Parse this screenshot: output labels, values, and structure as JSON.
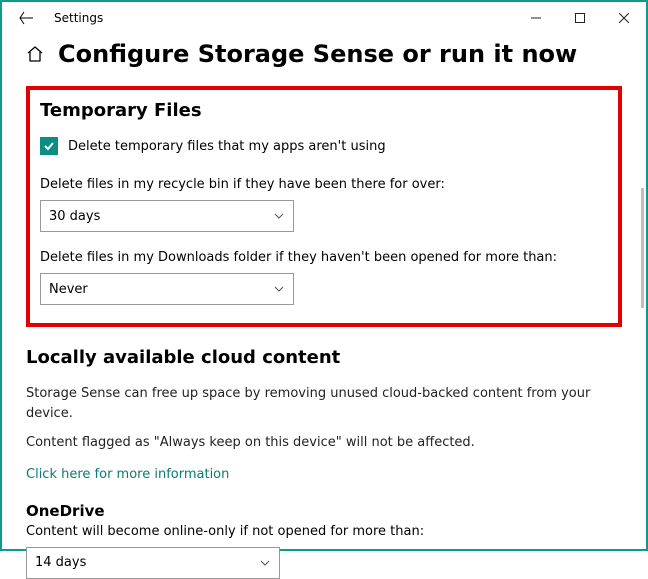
{
  "window": {
    "title": "Settings"
  },
  "page": {
    "title": "Configure Storage Sense or run it now"
  },
  "temporary_files": {
    "heading": "Temporary Files",
    "delete_temp_label": "Delete temporary files that my apps aren't using",
    "recycle_label": "Delete files in my recycle bin if they have been there for over:",
    "recycle_value": "30 days",
    "downloads_label": "Delete files in my Downloads folder if they haven't been opened for more than:",
    "downloads_value": "Never"
  },
  "cloud": {
    "heading": "Locally available cloud content",
    "desc1": "Storage Sense can free up space by removing unused cloud-backed content from your device.",
    "desc2": "Content flagged as \"Always keep on this device\" will not be affected.",
    "link": "Click here for more information"
  },
  "onedrive": {
    "heading": "OneDrive",
    "label": "Content will become online-only if not opened for more than:",
    "value": "14 days"
  }
}
